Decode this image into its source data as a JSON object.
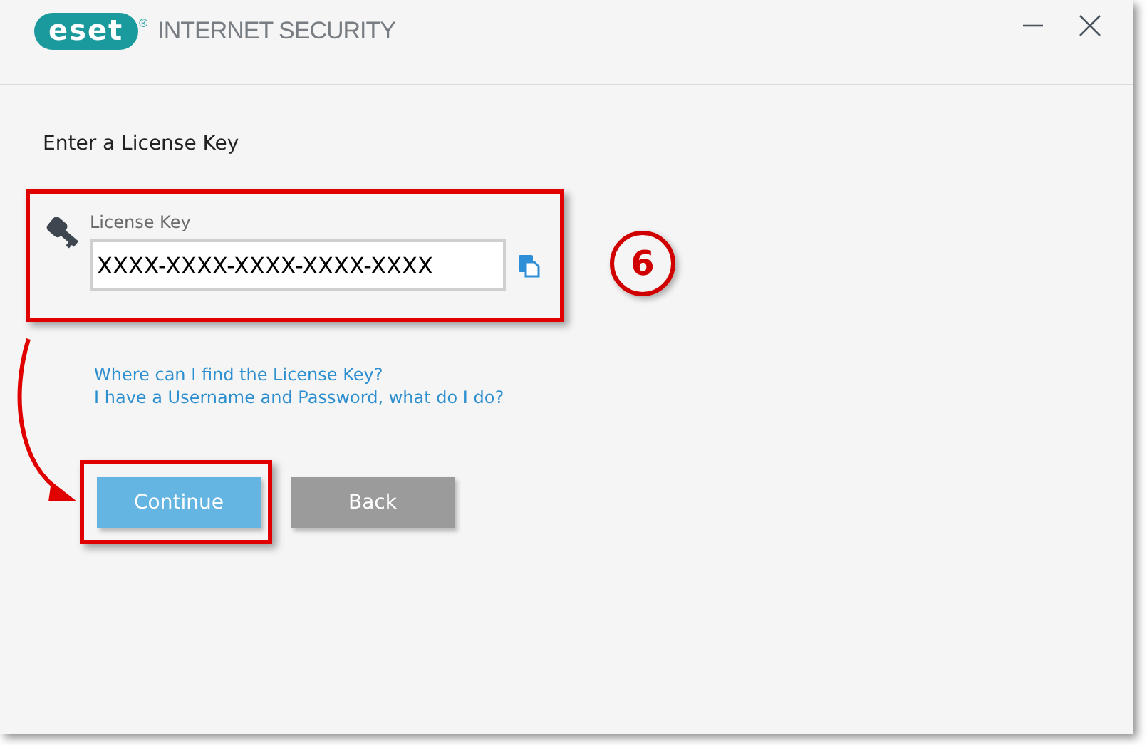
{
  "window": {
    "logo": "eset",
    "registered_mark": "®",
    "title": "INTERNET SECURITY"
  },
  "heading": "Enter a License Key",
  "license_field": {
    "label": "License Key",
    "value": "XXXX-XXXX-XXXX-XXXX-XXXX"
  },
  "links": [
    "Where can I find the License Key?",
    "I have a Username and Password, what do I do?"
  ],
  "buttons": [
    {
      "label": "Continue",
      "kind": "primary"
    },
    {
      "label": "Back",
      "kind": "secondary"
    }
  ],
  "annotation": {
    "step": "6"
  }
}
